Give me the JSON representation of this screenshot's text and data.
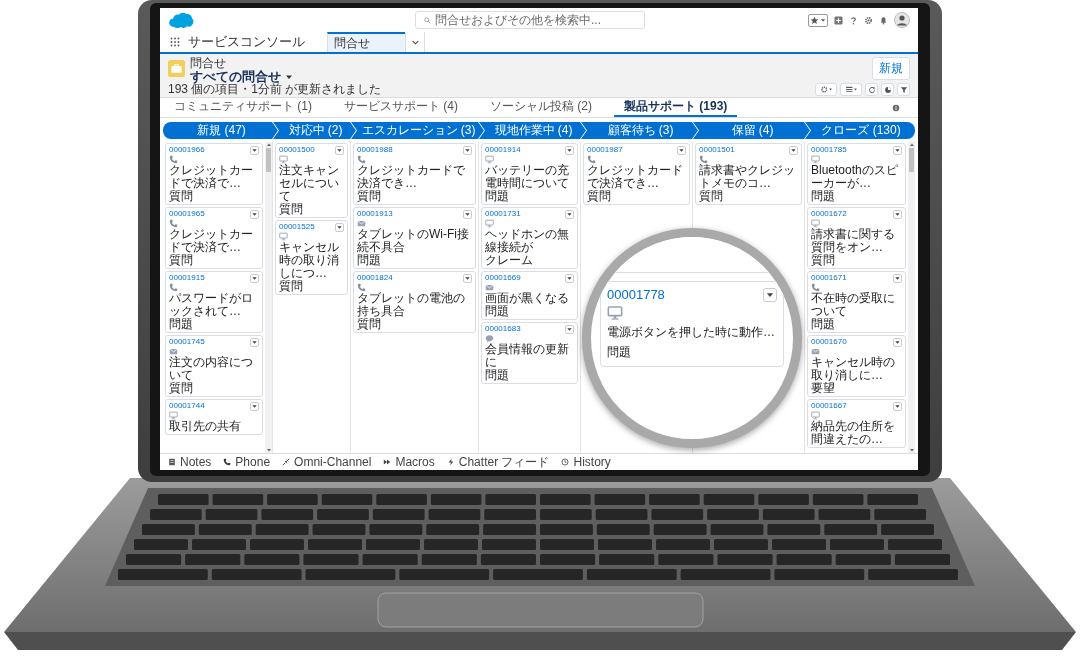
{
  "header": {
    "search": {
      "placeholder": "問合せおよびその他を検索中..."
    }
  },
  "nav": {
    "app_name": "サービスコンソール",
    "tabs": [
      {
        "label": "問合せ",
        "selected": true
      }
    ]
  },
  "list_view": {
    "object": "問合せ",
    "title": "すべての問合せ",
    "status": "193 個の項目・1分前 が更新されました",
    "new_button": "新規"
  },
  "tabs": [
    {
      "label": "コミュニティサポート (1)",
      "selected": false
    },
    {
      "label": "サービスサポート (4)",
      "selected": false
    },
    {
      "label": "ソーシャル投稿 (2)",
      "selected": false
    },
    {
      "label": "製品サポート (193)",
      "selected": true
    }
  ],
  "board": {
    "columns": [
      {
        "label": "新規 (47)",
        "scrollable": true,
        "cards": [
          {
            "id": "00001966",
            "kind": "phone",
            "title": "クレジットカードで決済で…",
            "category": "質問"
          },
          {
            "id": "00001965",
            "kind": "phone",
            "title": "クレジットカードで決済で…",
            "category": "質問"
          },
          {
            "id": "00001915",
            "kind": "phone",
            "title": "パスワードがロックされて…",
            "category": "問題"
          },
          {
            "id": "00001745",
            "kind": "email",
            "title": "注文の内容について",
            "category": "質問"
          },
          {
            "id": "00001744",
            "kind": "web",
            "title": "取引先の共有"
          }
        ]
      },
      {
        "label": "対応中 (2)",
        "scrollable": false,
        "cards": [
          {
            "id": "00001500",
            "kind": "web",
            "title": "注文キャンセルについて",
            "category": "質問"
          },
          {
            "id": "00001525",
            "kind": "web",
            "title": "キャンセル時の取り消しにつ…",
            "category": "質問"
          }
        ]
      },
      {
        "label": "エスカレーション (3)",
        "scrollable": false,
        "cards": [
          {
            "id": "00001988",
            "kind": "phone",
            "title": "クレジットカードで決済でき…",
            "category": "質問"
          },
          {
            "id": "00001913",
            "kind": "email",
            "title": "タブレットのWi-Fi接続不具合",
            "category": "問題"
          },
          {
            "id": "00001824",
            "kind": "phone",
            "title": "タブレットの電池の持ち具合",
            "category": "質問"
          }
        ]
      },
      {
        "label": "現地作業中 (4)",
        "scrollable": false,
        "cards": [
          {
            "id": "00001914",
            "kind": "web",
            "title": "バッテリーの充電時間について",
            "category": "問題"
          },
          {
            "id": "00001731",
            "kind": "web",
            "title": "ヘッドホンの無線接続が",
            "category": "クレーム"
          },
          {
            "id": "00001669",
            "kind": "email",
            "title": "画面が黒くなる",
            "category": "問題"
          },
          {
            "id": "00001683",
            "kind": "chat",
            "title": "会員情報の更新に",
            "category": "問題"
          }
        ]
      },
      {
        "label": "顧客待ち (3)",
        "scrollable": false,
        "cards": [
          {
            "id": "00001987",
            "kind": "phone",
            "title": "クレジットカードで決済でき…",
            "category": "質問"
          }
        ]
      },
      {
        "label": "保留 (4)",
        "scrollable": false,
        "cards": [
          {
            "id": "00001501",
            "kind": "phone",
            "title": "請求書やクレジットメモのコ…",
            "category": "質問"
          }
        ]
      },
      {
        "label": "クローズ (130)",
        "scrollable": true,
        "cards": [
          {
            "id": "00001785",
            "kind": "web",
            "title": "Bluetoothのスピーカーが…",
            "category": "問題"
          },
          {
            "id": "00001672",
            "kind": "web",
            "title": "請求書に関する質問をオン…",
            "category": "質問"
          },
          {
            "id": "00001671",
            "kind": "phone",
            "title": "不在時の受取について",
            "category": "問題"
          },
          {
            "id": "00001670",
            "kind": "email",
            "title": "キャンセル時の取り消しに…",
            "category": "要望"
          },
          {
            "id": "00001667",
            "kind": "web",
            "title": "納品先の住所を間違えたの…"
          }
        ]
      }
    ]
  },
  "magnifier": {
    "card": {
      "id": "00001778",
      "kind": "web",
      "title": "電源ボタンを押した時に動作…",
      "category": "問題"
    }
  },
  "utility_bar": [
    {
      "label": "Notes",
      "kind": "notes"
    },
    {
      "label": "Phone",
      "kind": "phone"
    },
    {
      "label": "Omni-Channel",
      "kind": "omni"
    },
    {
      "label": "Macros",
      "kind": "macros"
    },
    {
      "label": "Chatter フィード",
      "kind": "chatter"
    },
    {
      "label": "History",
      "kind": "history"
    }
  ]
}
